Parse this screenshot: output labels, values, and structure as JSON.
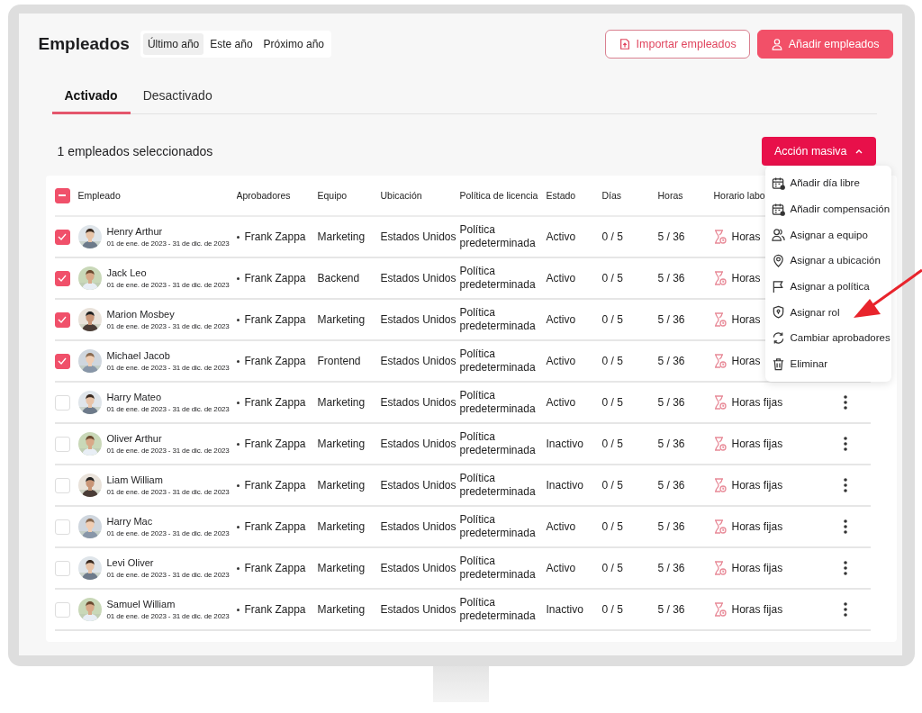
{
  "header": {
    "title": "Empleados",
    "periods": [
      {
        "label": "Último año",
        "selected": true
      },
      {
        "label": "Este año",
        "selected": false
      },
      {
        "label": "Próximo año",
        "selected": false
      }
    ],
    "import_button": "Importar empleados",
    "add_button": "Añadir empleados"
  },
  "tabs": [
    {
      "label": "Activado",
      "selected": true
    },
    {
      "label": "Desactivado",
      "selected": false
    }
  ],
  "selection_count": "1 empleados seleccionados",
  "bulk_button": {
    "label": "Acción masiva",
    "expanded": true
  },
  "bulk_menu": [
    {
      "label": "Añadir día libre",
      "kind": "calendar"
    },
    {
      "label": "Añadir compensación",
      "kind": "calendar"
    },
    {
      "label": "Asignar a equipo",
      "kind": "people"
    },
    {
      "label": "Asignar a ubicación",
      "kind": "pin"
    },
    {
      "label": "Asignar a política",
      "kind": "flag"
    },
    {
      "label": "Asignar rol",
      "kind": "shield"
    },
    {
      "label": "Cambiar aprobadores",
      "kind": "refresh"
    },
    {
      "label": "Eliminar",
      "kind": "trash"
    }
  ],
  "table": {
    "all_checkbox": {
      "indeterminate": true
    },
    "columns": [
      "Empleado",
      "Aprobadores",
      "Equipo",
      "Ubicación",
      "Política de licencia",
      "Estado",
      "Días",
      "Horas",
      "Horario labo"
    ],
    "rows": [
      {
        "selected": true,
        "covered": true,
        "name": "Henry Arthur",
        "dates": "01 de ene. de 2023 - 31 de dic. de 2023",
        "approver": "Frank Zappa",
        "team": "Marketing",
        "location": "Estados Unidos",
        "policy": "Política predeterminada",
        "status": "Activo",
        "days": "0 / 5",
        "hours": "5 / 36",
        "schedule": "Horas"
      },
      {
        "selected": true,
        "covered": true,
        "name": "Jack Leo",
        "dates": "01 de ene. de 2023 - 31 de dic. de 2023",
        "approver": "Frank Zappa",
        "team": "Backend",
        "location": "Estados Unidos",
        "policy": "Política predeterminada",
        "status": "Activo",
        "days": "0 / 5",
        "hours": "5 / 36",
        "schedule": "Horas"
      },
      {
        "selected": true,
        "covered": true,
        "name": "Marion Mosbey",
        "dates": "01 de ene. de 2023 - 31 de dic. de 2023",
        "approver": "Frank Zappa",
        "team": "Marketing",
        "location": "Estados Unidos",
        "policy": "Política predeterminada",
        "status": "Activo",
        "days": "0 / 5",
        "hours": "5 / 36",
        "schedule": "Horas"
      },
      {
        "selected": true,
        "covered": true,
        "name": "Michael Jacob",
        "dates": "01 de ene. de 2023 - 31 de dic. de 2023",
        "approver": "Frank Zappa",
        "team": "Frontend",
        "location": "Estados Unidos",
        "policy": "Política predeterminada",
        "status": "Activo",
        "days": "0 / 5",
        "hours": "5 / 36",
        "schedule": "Horas"
      },
      {
        "selected": false,
        "covered": false,
        "name": "Harry Mateo",
        "dates": "01 de ene. de 2023 - 31 de dic. de 2023",
        "approver": "Frank Zappa",
        "team": "Marketing",
        "location": "Estados Unidos",
        "policy": "Política predeterminada",
        "status": "Activo",
        "days": "0 / 5",
        "hours": "5 / 36",
        "schedule": "Horas fijas"
      },
      {
        "selected": false,
        "covered": false,
        "name": "Oliver Arthur",
        "dates": "01 de ene. de 2023 - 31 de dic. de 2023",
        "approver": "Frank Zappa",
        "team": "Marketing",
        "location": "Estados Unidos",
        "policy": "Política predeterminada",
        "status": "Inactivo",
        "days": "0 / 5",
        "hours": "5 / 36",
        "schedule": "Horas fijas"
      },
      {
        "selected": false,
        "covered": false,
        "name": "Liam William",
        "dates": "01 de ene. de 2023 - 31 de dic. de 2023",
        "approver": "Frank Zappa",
        "team": "Marketing",
        "location": "Estados Unidos",
        "policy": "Política predeterminada",
        "status": "Inactivo",
        "days": "0 / 5",
        "hours": "5 / 36",
        "schedule": "Horas fijas"
      },
      {
        "selected": false,
        "covered": false,
        "name": "Harry Mac",
        "dates": "01 de ene. de 2023 - 31 de dic. de 2023",
        "approver": "Frank Zappa",
        "team": "Marketing",
        "location": "Estados Unidos",
        "policy": "Política predeterminada",
        "status": "Activo",
        "days": "0 / 5",
        "hours": "5 / 36",
        "schedule": "Horas fijas"
      },
      {
        "selected": false,
        "covered": false,
        "name": "Levi Oliver",
        "dates": "01 de ene. de 2023 - 31 de dic. de 2023",
        "approver": "Frank Zappa",
        "team": "Marketing",
        "location": "Estados Unidos",
        "policy": "Política predeterminada",
        "status": "Activo",
        "days": "0 / 5",
        "hours": "5 / 36",
        "schedule": "Horas fijas"
      },
      {
        "selected": false,
        "covered": false,
        "name": "Samuel William",
        "dates": "01 de ene. de 2023 - 31 de dic. de 2023",
        "approver": "Frank Zappa",
        "team": "Marketing",
        "location": "Estados Unidos",
        "policy": "Política predeterminada",
        "status": "Inactivo",
        "days": "0 / 5",
        "hours": "5 / 36",
        "schedule": "Horas fijas"
      }
    ]
  }
}
